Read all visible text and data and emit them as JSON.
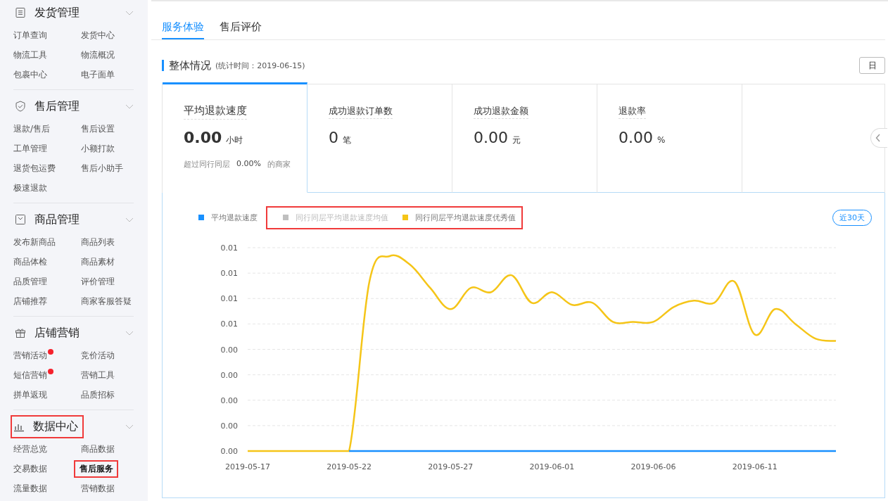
{
  "sidebar": {
    "sections": [
      {
        "title": "发货管理",
        "highlighted": false,
        "items": [
          {
            "label": "订单查询",
            "selected": false,
            "badge": false
          },
          {
            "label": "发货中心",
            "selected": false,
            "badge": false
          },
          {
            "label": "物流工具",
            "selected": false,
            "badge": false
          },
          {
            "label": "物流概况",
            "selected": false,
            "badge": false
          },
          {
            "label": "包裹中心",
            "selected": false,
            "badge": false
          },
          {
            "label": "电子面单",
            "selected": false,
            "badge": false
          }
        ]
      },
      {
        "title": "售后管理",
        "highlighted": false,
        "items": [
          {
            "label": "退款/售后",
            "selected": false,
            "badge": false
          },
          {
            "label": "售后设置",
            "selected": false,
            "badge": false
          },
          {
            "label": "工单管理",
            "selected": false,
            "badge": false
          },
          {
            "label": "小额打款",
            "selected": false,
            "badge": false
          },
          {
            "label": "退货包运费",
            "selected": false,
            "badge": false
          },
          {
            "label": "售后小助手",
            "selected": false,
            "badge": false
          },
          {
            "label": "极速退款",
            "selected": false,
            "badge": false
          }
        ]
      },
      {
        "title": "商品管理",
        "highlighted": false,
        "items": [
          {
            "label": "发布新商品",
            "selected": false,
            "badge": false
          },
          {
            "label": "商品列表",
            "selected": false,
            "badge": false
          },
          {
            "label": "商品体检",
            "selected": false,
            "badge": false
          },
          {
            "label": "商品素材",
            "selected": false,
            "badge": false
          },
          {
            "label": "品质管理",
            "selected": false,
            "badge": false
          },
          {
            "label": "评价管理",
            "selected": false,
            "badge": false
          },
          {
            "label": "店铺推荐",
            "selected": false,
            "badge": false
          },
          {
            "label": "商家客服答疑",
            "selected": false,
            "badge": false
          }
        ]
      },
      {
        "title": "店铺营销",
        "highlighted": false,
        "items": [
          {
            "label": "营销活动",
            "selected": false,
            "badge": true
          },
          {
            "label": "竞价活动",
            "selected": false,
            "badge": false
          },
          {
            "label": "短信营销",
            "selected": false,
            "badge": true
          },
          {
            "label": "营销工具",
            "selected": false,
            "badge": false
          },
          {
            "label": "拼单返现",
            "selected": false,
            "badge": false
          },
          {
            "label": "品质招标",
            "selected": false,
            "badge": false
          }
        ]
      },
      {
        "title": "数据中心",
        "highlighted": true,
        "items": [
          {
            "label": "经营总览",
            "selected": false,
            "badge": false
          },
          {
            "label": "商品数据",
            "selected": false,
            "badge": false
          },
          {
            "label": "交易数据",
            "selected": false,
            "badge": false
          },
          {
            "label": "售后服务",
            "selected": true,
            "badge": false
          },
          {
            "label": "流量数据",
            "selected": false,
            "badge": false
          },
          {
            "label": "营销数据",
            "selected": false,
            "badge": false
          }
        ]
      }
    ]
  },
  "tabs": [
    {
      "label": "服务体验",
      "selected": true
    },
    {
      "label": "售后评价",
      "selected": false
    }
  ],
  "overview": {
    "title": "整体情况",
    "subtitle": "(统计时间：2019-06-15)",
    "period_button": "日"
  },
  "metrics": [
    {
      "title": "平均退款速度",
      "value": "0.00",
      "unit": "小时",
      "selected": true,
      "note_label": "超过同行同层",
      "note_value": "0.00%",
      "note_suffix": "的商家"
    },
    {
      "title": "成功退款订单数",
      "value": "0",
      "unit": "笔",
      "selected": false
    },
    {
      "title": "成功退款金额",
      "value": "0.00",
      "unit": "元",
      "selected": false
    },
    {
      "title": "退款率",
      "value": "0.00",
      "unit": "%",
      "selected": false
    }
  ],
  "trend": {
    "legend_highlighted": true,
    "range_button": "近30天",
    "chart_data": {
      "type": "line",
      "categories": [
        "2019-05-17",
        null,
        null,
        null,
        null,
        "2019-05-22",
        null,
        null,
        null,
        null,
        "2019-05-27",
        null,
        null,
        null,
        null,
        "2019-06-01",
        null,
        null,
        null,
        null,
        "2019-06-06",
        null,
        null,
        null,
        null,
        "2019-06-11",
        null,
        null,
        null,
        null
      ],
      "ylim": [
        0,
        0.0096
      ],
      "grid": true,
      "yticks": [
        {
          "value": 0,
          "label": "0.00"
        },
        {
          "value": 0.0012,
          "label": "0.00"
        },
        {
          "value": 0.0024,
          "label": "0.00"
        },
        {
          "value": 0.0036,
          "label": "0.00"
        },
        {
          "value": 0.0048,
          "label": "0.00"
        },
        {
          "value": 0.006,
          "label": "0.01"
        },
        {
          "value": 0.0072,
          "label": "0.01"
        },
        {
          "value": 0.0084,
          "label": "0.01"
        },
        {
          "value": 0.0096,
          "label": "0.01"
        }
      ],
      "series": [
        {
          "name": "平均退款速度",
          "color": "#1890ff",
          "values": [
            null,
            null,
            null,
            null,
            null,
            0,
            0,
            0,
            0,
            0,
            0,
            0,
            0,
            0,
            0,
            0,
            0,
            0,
            0,
            0,
            0,
            0,
            0,
            0,
            0,
            0,
            0,
            0,
            0,
            0
          ]
        },
        {
          "name": "同行同层平均退款速度均值",
          "color": "#bfbfbf",
          "values": [
            null,
            null,
            null,
            null,
            null,
            null,
            null,
            null,
            null,
            null,
            null,
            null,
            null,
            null,
            null,
            null,
            null,
            null,
            null,
            null,
            null,
            null,
            null,
            null,
            null,
            null,
            null,
            null,
            null,
            null
          ]
        },
        {
          "name": "同行同层平均退款速度优秀值",
          "color": "#f5c518",
          "values": [
            0,
            0,
            0,
            0,
            0,
            0,
            0.008,
            0.0092,
            0.0088,
            0.0077,
            0.0067,
            0.0077,
            0.0075,
            0.0083,
            0.007,
            0.0075,
            0.0069,
            0.007,
            0.0061,
            0.0061,
            0.0061,
            0.0068,
            0.0071,
            0.007,
            0.008,
            0.0055,
            0.0067,
            0.006,
            0.0053,
            0.0052
          ]
        }
      ]
    }
  }
}
